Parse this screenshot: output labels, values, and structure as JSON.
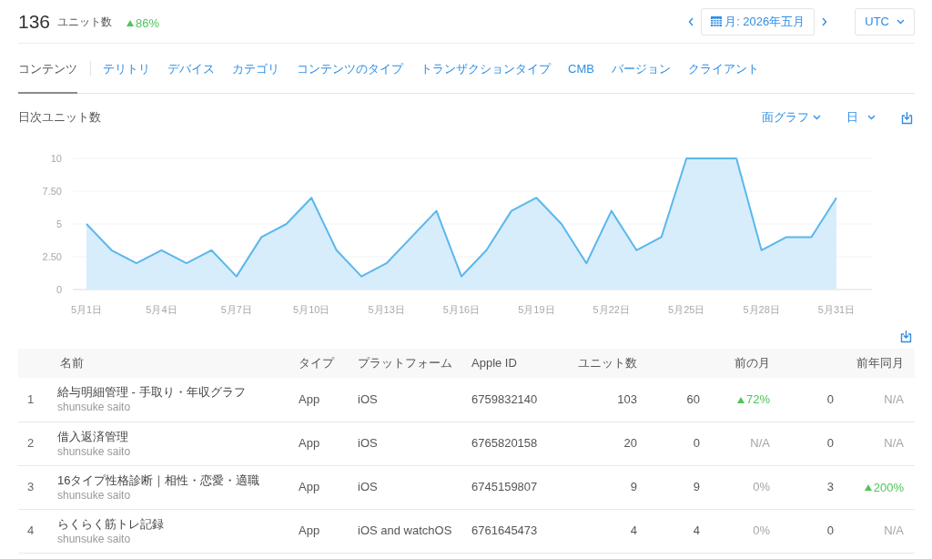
{
  "summary": {
    "value": "136",
    "label": "ユニット数",
    "change": "86%",
    "rising": true
  },
  "period": {
    "label": "月: 2026年五月"
  },
  "timezone": {
    "label": "UTC"
  },
  "tabs": [
    {
      "label": "コンテンツ",
      "selected": true
    },
    {
      "label": "テリトリ",
      "selected": false
    },
    {
      "label": "デバイス",
      "selected": false
    },
    {
      "label": "カテゴリ",
      "selected": false
    },
    {
      "label": "コンテンツのタイプ",
      "selected": false
    },
    {
      "label": "トランザクションタイプ",
      "selected": false
    },
    {
      "label": "CMB",
      "selected": false
    },
    {
      "label": "バージョン",
      "selected": false
    },
    {
      "label": "クライアント",
      "selected": false
    }
  ],
  "chart_panel": {
    "chart_type": "面グラフ",
    "interval": "日",
    "chart_data": {
      "type": "area",
      "title": "日次ユニット数",
      "grid": true,
      "categories": [
        "5月1日",
        null,
        null,
        "5月4日",
        null,
        null,
        "5月7日",
        null,
        null,
        "5月10日",
        null,
        null,
        "5月13日",
        null,
        null,
        "5月16日",
        null,
        null,
        "5月19日",
        null,
        null,
        "5月22日",
        null,
        null,
        "5月25日",
        null,
        null,
        "5月28日",
        null,
        null,
        "5月31日"
      ],
      "values": [
        5,
        3,
        2,
        3,
        2,
        3,
        1,
        4,
        5,
        7,
        3,
        1,
        2,
        4,
        6,
        1,
        3,
        6,
        7,
        5,
        2,
        6,
        3,
        4,
        10,
        10,
        10,
        3,
        4,
        4,
        7
      ],
      "ylim": [
        0,
        10
      ],
      "yticks": [
        {
          "value": 0,
          "label": "0"
        },
        {
          "value": 2.5,
          "label": "2.50"
        },
        {
          "value": 5,
          "label": "5"
        },
        {
          "value": 7.5,
          "label": "7.50"
        },
        {
          "value": 10,
          "label": "10"
        }
      ]
    }
  },
  "table": {
    "columns": [
      {
        "label": "名前",
        "kind": "text"
      },
      {
        "label": "タイプ",
        "kind": "text"
      },
      {
        "label": "プラットフォーム",
        "kind": "text"
      },
      {
        "label": "Apple ID",
        "kind": "text"
      },
      {
        "label": "ユニット数",
        "kind": "number"
      },
      {
        "label": "前の月",
        "kind": "compare"
      },
      {
        "label": "前年同月",
        "kind": "compare"
      }
    ],
    "rows": [
      {
        "rank": "1",
        "name": "給与明細管理 - 手取り・年収グラフ",
        "developer": "shunsuke saito",
        "type": "App",
        "platform": "iOS",
        "apple_id": "6759832140",
        "units": "103",
        "prev_month": {
          "units": "60",
          "change": "72%",
          "rising": true
        },
        "prev_year": {
          "units": "0",
          "change": "N/A",
          "rising": false
        }
      },
      {
        "rank": "2",
        "name": "借入返済管理",
        "developer": "shunsuke saito",
        "type": "App",
        "platform": "iOS",
        "apple_id": "6765820158",
        "units": "20",
        "prev_month": {
          "units": "0",
          "change": "N/A",
          "rising": false
        },
        "prev_year": {
          "units": "0",
          "change": "N/A",
          "rising": false
        }
      },
      {
        "rank": "3",
        "name": "16タイプ性格診断｜相性・恋愛・適職",
        "developer": "shunsuke saito",
        "type": "App",
        "platform": "iOS",
        "apple_id": "6745159807",
        "units": "9",
        "prev_month": {
          "units": "9",
          "change": "0%",
          "rising": false
        },
        "prev_year": {
          "units": "3",
          "change": "200%",
          "rising": true
        }
      },
      {
        "rank": "4",
        "name": "らくらく筋トレ記録",
        "developer": "shunsuke saito",
        "type": "App",
        "platform": "iOS and watchOS",
        "apple_id": "6761645473",
        "units": "4",
        "prev_month": {
          "units": "4",
          "change": "0%",
          "rising": false
        },
        "prev_year": {
          "units": "0",
          "change": "N/A",
          "rising": false
        }
      }
    ]
  }
}
